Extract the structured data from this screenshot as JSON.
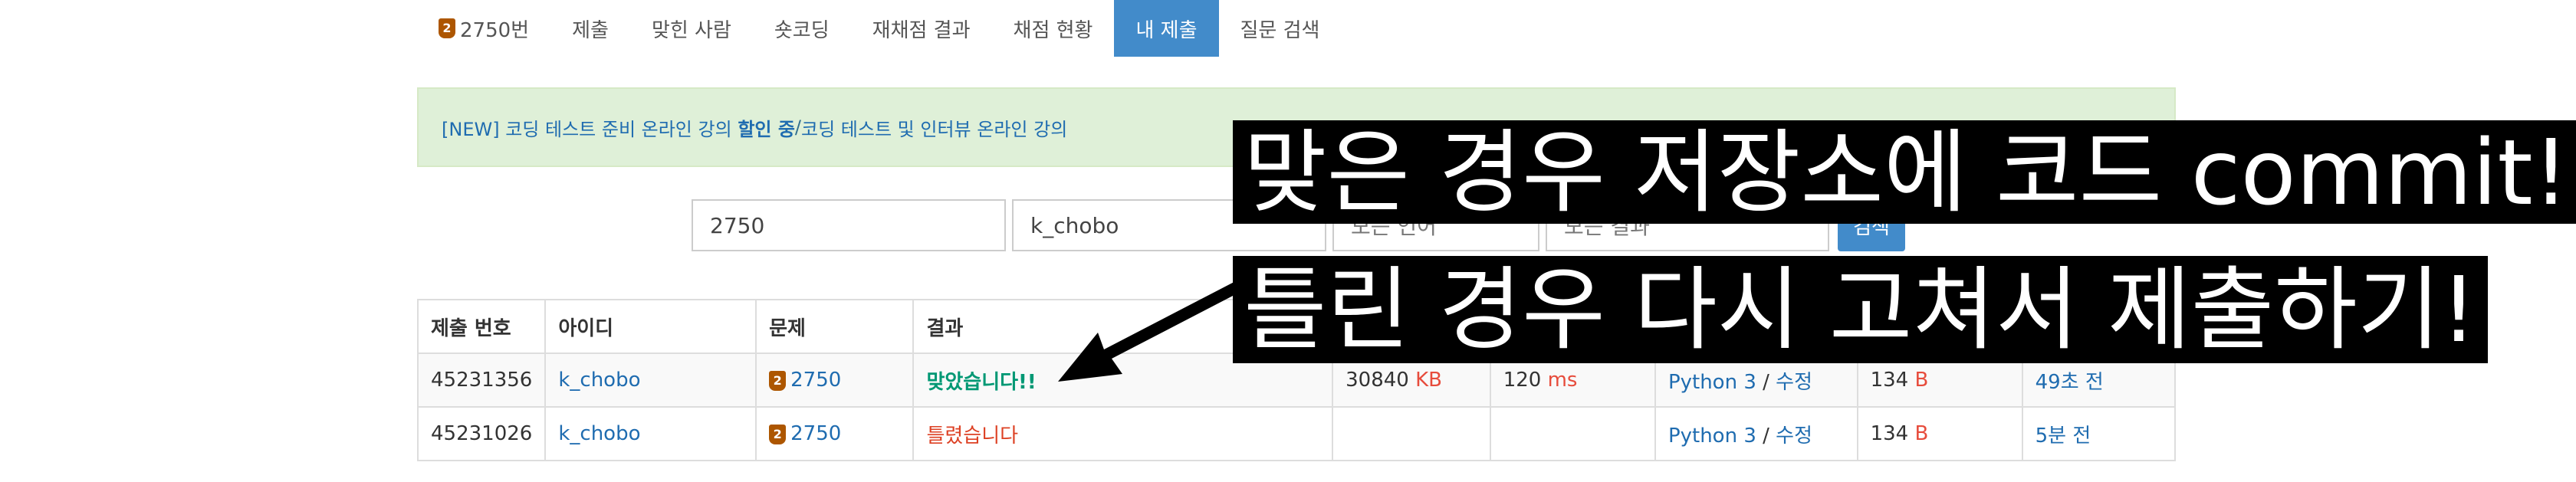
{
  "nav": {
    "problem_tier": "2",
    "problem_label": "2750번",
    "tabs": [
      "제출",
      "맞힌 사람",
      "숏코딩",
      "재채점 결과",
      "채점 현황"
    ],
    "active_tab": "내 제출",
    "last_tab": "질문 검색"
  },
  "alert": {
    "prefix": "[NEW] 코딩 테스트 준비 온라인 강의 ",
    "highlight": "할인 중",
    "separator": " / ",
    "link2": "코딩 테스트 및 인터뷰 온라인 강의",
    "close": "×"
  },
  "filters": {
    "problem_id": "2750",
    "user_id": "k_chobo",
    "language": "모든 언어",
    "result": "모든 결과",
    "search_label": "검색"
  },
  "table": {
    "headers": [
      "제출 번호",
      "아이디",
      "문제",
      "결과"
    ],
    "rows": [
      {
        "id": "45231356",
        "user": "k_chobo",
        "tier": "2",
        "problem": "2750",
        "result": "맞았습니다!!",
        "memory": "30840",
        "memory_unit": "KB",
        "time": "120",
        "time_unit": "ms",
        "lang": "Python 3",
        "edit": "수정",
        "length": "134",
        "length_unit": "B",
        "ago": "49초 전"
      },
      {
        "id": "45231026",
        "user": "k_chobo",
        "tier": "2",
        "problem": "2750",
        "result": "틀렸습니다",
        "memory": "",
        "memory_unit": "",
        "time": "",
        "time_unit": "",
        "lang": "Python 3",
        "edit": "수정",
        "length": "134",
        "length_unit": "B",
        "ago": "5분 전"
      }
    ]
  },
  "overlays": {
    "top": "맞은 경우 저장소에 코드 commit!",
    "bottom": "틀린 경우 다시 고쳐서 제출하기!"
  },
  "colors": {
    "accent": "#428bca",
    "accepted": "#009874",
    "wrong": "#dd4124",
    "link": "#1f6cb0"
  }
}
